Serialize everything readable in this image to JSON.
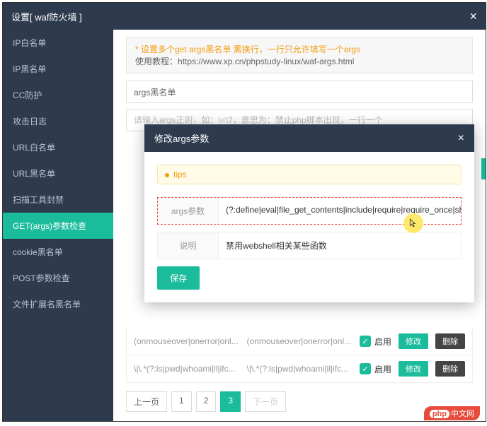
{
  "window": {
    "title": "设置[ waf防火墙 ]"
  },
  "sidebar": {
    "items": [
      {
        "label": "IP白名单"
      },
      {
        "label": "IP黑名单"
      },
      {
        "label": "CC防护"
      },
      {
        "label": "攻击日志"
      },
      {
        "label": "URL白名单"
      },
      {
        "label": "URL黑名单"
      },
      {
        "label": "扫描工具封禁"
      },
      {
        "label": "GET(args)参数检查",
        "active": true
      },
      {
        "label": "cookie黑名单"
      },
      {
        "label": "POST参数检查"
      },
      {
        "label": "文件扩展名黑名单"
      }
    ]
  },
  "info": {
    "line1": "* 设置多个get args黑名单 需换行，一行只允许填写一个args",
    "line2_prefix": "使用教程：",
    "line2_url": "https://www.xp.cn/phpstudy-linux/waf-args.html"
  },
  "inputs": {
    "title_value": "args黑名单",
    "rule_placeholder": "请输入args正则，如：\\<\\?，意思为：禁止php脚本出现，一行一个"
  },
  "table": {
    "rows": [
      {
        "p1": "(onmouseover|onerror|onl...",
        "p2": "(onmouseover|onerror|onl...",
        "status": "启用",
        "edit": "修改",
        "del": "删除"
      },
      {
        "p1": "\\|\\.*(?:ls|pwd|whoami|ll|ifc...",
        "p2": "\\|\\.*(?:ls|pwd|whoami|ll|ifc...",
        "status": "启用",
        "edit": "修改",
        "del": "删除"
      }
    ]
  },
  "pagination": {
    "prev": "上一页",
    "p1": "1",
    "p2": "2",
    "p3": "3",
    "next": "下一页"
  },
  "modal": {
    "title": "修改args参数",
    "tips": "tips",
    "field1_label": "args参数",
    "field1_value": "(?:define|eval|file_get_contents|include|require|require_once|shell_exe",
    "field2_label": "说明",
    "field2_value": "禁用webshell相关某些函数",
    "save": "保存"
  },
  "watermark": "中文网"
}
